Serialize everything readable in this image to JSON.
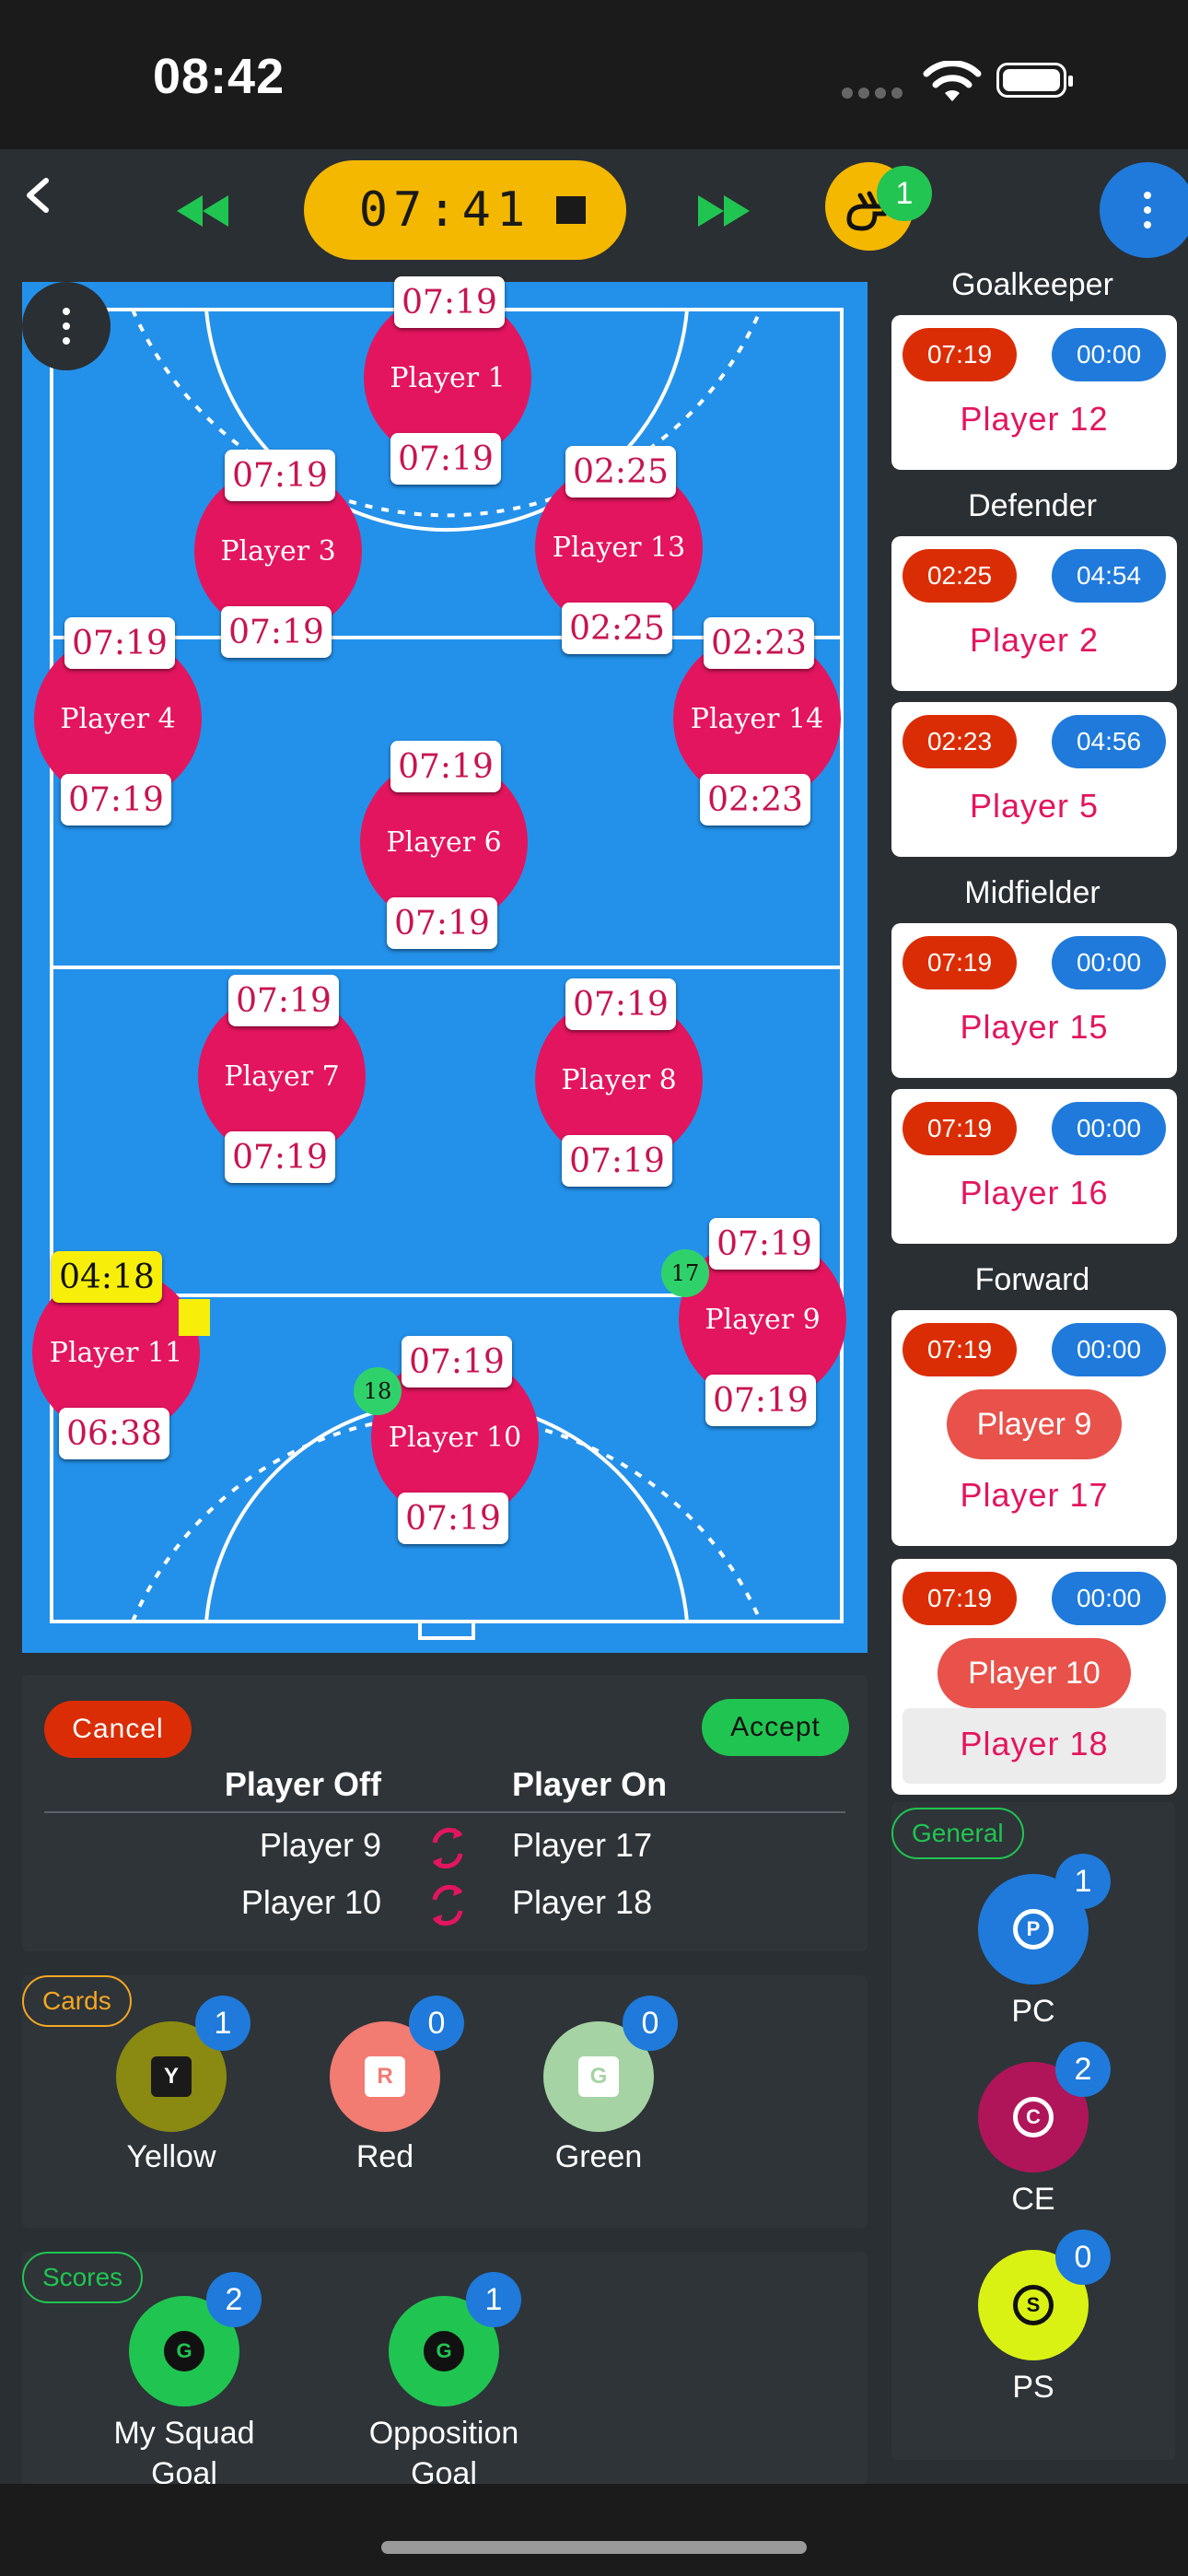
{
  "status_bar": {
    "time": "08:42"
  },
  "header": {
    "timer": "07:41",
    "whistle_badge": "1"
  },
  "pitch_players": [
    {
      "name": "Player 1",
      "top_time": "07:19",
      "bottom_time": "07:19"
    },
    {
      "name": "Player 3",
      "top_time": "07:19",
      "bottom_time": "07:19"
    },
    {
      "name": "Player 13",
      "top_time": "02:25",
      "bottom_time": "02:25"
    },
    {
      "name": "Player 4",
      "top_time": "07:19",
      "bottom_time": "07:19"
    },
    {
      "name": "Player 14",
      "top_time": "02:23",
      "bottom_time": "02:23"
    },
    {
      "name": "Player 6",
      "top_time": "07:19",
      "bottom_time": "07:19"
    },
    {
      "name": "Player 7",
      "top_time": "07:19",
      "bottom_time": "07:19"
    },
    {
      "name": "Player 8",
      "top_time": "07:19",
      "bottom_time": "07:19"
    },
    {
      "name": "Player 11",
      "top_time": "04:18",
      "bottom_time": "06:38"
    },
    {
      "name": "Player 9",
      "top_time": "07:19",
      "bottom_time": "07:19",
      "sub_number": "17"
    },
    {
      "name": "Player 10",
      "top_time": "07:19",
      "bottom_time": "07:19",
      "sub_number": "18"
    }
  ],
  "positions": {
    "goalkeeper": {
      "title": "Goalkeeper",
      "cards": [
        {
          "t1": "07:19",
          "t2": "00:00",
          "name": "Player 12"
        }
      ]
    },
    "defender": {
      "title": "Defender",
      "cards": [
        {
          "t1": "02:25",
          "t2": "04:54",
          "name": "Player 2"
        },
        {
          "t1": "02:23",
          "t2": "04:56",
          "name": "Player 5"
        }
      ]
    },
    "midfielder": {
      "title": "Midfielder",
      "cards": [
        {
          "t1": "07:19",
          "t2": "00:00",
          "name": "Player 15"
        },
        {
          "t1": "07:19",
          "t2": "00:00",
          "name": "Player 16"
        }
      ]
    },
    "forward": {
      "title": "Forward",
      "cards": [
        {
          "t1": "07:19",
          "t2": "00:00",
          "pill": "Player 9",
          "name": "Player 17"
        },
        {
          "t1": "07:19",
          "t2": "00:00",
          "pill": "Player 10",
          "name": "Player 18"
        }
      ]
    }
  },
  "substitution": {
    "cancel": "Cancel",
    "accept": "Accept",
    "off_header": "Player Off",
    "on_header": "Player On",
    "rows": [
      {
        "off": "Player 9",
        "on": "Player 17"
      },
      {
        "off": "Player 10",
        "on": "Player 18"
      }
    ]
  },
  "cards": {
    "tag": "Cards",
    "items": [
      {
        "label": "Yellow",
        "letter": "Y",
        "count": "1",
        "color": "#8a8a12"
      },
      {
        "label": "Red",
        "letter": "R",
        "count": "0",
        "color": "#f27b72"
      },
      {
        "label": "Green",
        "letter": "G",
        "count": "0",
        "color": "#a6d3a3"
      }
    ]
  },
  "scores": {
    "tag": "Scores",
    "items": [
      {
        "label": "My Squad",
        "label2": "Goal",
        "letter": "G",
        "count": "2"
      },
      {
        "label": "Opposition",
        "label2": "Goal",
        "letter": "G",
        "count": "1"
      }
    ]
  },
  "general": {
    "tag": "General",
    "items": [
      {
        "label": "PC",
        "letter": "P",
        "count": "1",
        "color": "#1f7adb"
      },
      {
        "label": "CE",
        "letter": "C",
        "count": "2",
        "color": "#b0155a"
      },
      {
        "label": "PS",
        "letter": "S",
        "count": "0",
        "color": "#d9f214"
      }
    ]
  }
}
